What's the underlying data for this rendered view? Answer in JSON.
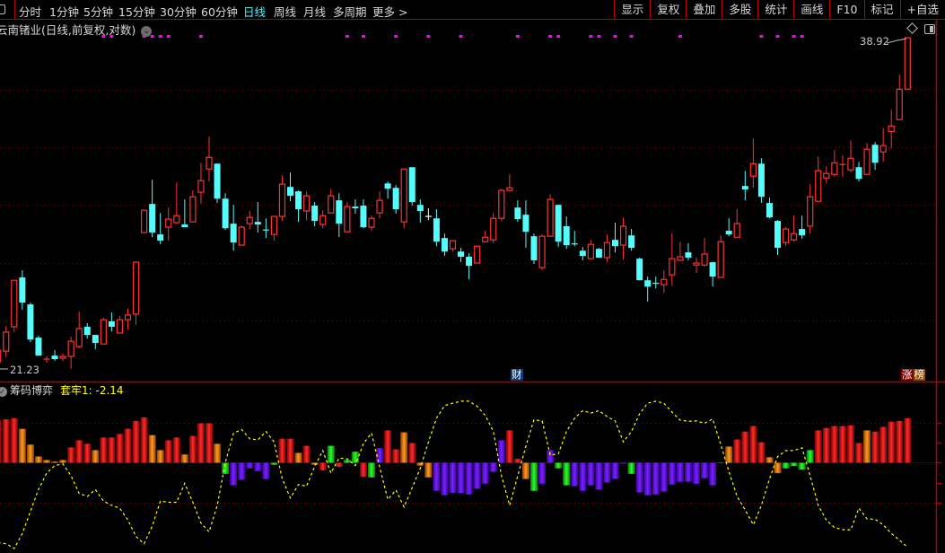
{
  "toolbar": {
    "periods": [
      "分时",
      "1分钟",
      "5分钟",
      "15分钟",
      "30分钟",
      "60分钟",
      "日线",
      "周线",
      "月线",
      "多周期",
      "更多 >"
    ],
    "active_period": "日线",
    "buttons": [
      "显示",
      "复权",
      "叠加",
      "多股",
      "统计",
      "画线",
      "F10",
      "标记",
      "+自选"
    ]
  },
  "title": "云南锗业(日线,前复权,对数)",
  "price_labels": {
    "high": "38.92",
    "low": "21.23"
  },
  "tags": {
    "finance": "财",
    "rank_a": "涨",
    "rank_b": "榜"
  },
  "indicator": {
    "name": "筹码博弈",
    "value_label": "套牢1: -2.14"
  },
  "colors": {
    "up": "#ff3232",
    "down": "#54fcfc",
    "doji": "#ffffff",
    "grid": "#8a0000",
    "frame": "#b00000",
    "signal": "#ff00ff",
    "line": "#ffff00",
    "R": "#ff2020",
    "O": "#ff8a1c",
    "G": "#1ee81e",
    "P": "#6a12ff"
  },
  "chart_data": [
    {
      "type": "candlestick",
      "scale": "log",
      "price_range": [
        21.23,
        38.92
      ],
      "fields": [
        "open",
        "close",
        "high",
        "low"
      ],
      "candles": [
        [
          21.48,
          21.94,
          22.01,
          21.23
        ],
        [
          21.9,
          22.68,
          22.94,
          21.65
        ],
        [
          22.9,
          24.94,
          24.94,
          22.68
        ],
        [
          25.07,
          23.94,
          25.4,
          23.63
        ],
        [
          23.86,
          22.37,
          23.94,
          22.26
        ],
        [
          22.45,
          21.72,
          22.53,
          21.72
        ],
        [
          21.56,
          21.58,
          21.69,
          21.44
        ],
        [
          21.72,
          21.58,
          21.94,
          21.51
        ],
        [
          21.62,
          21.69,
          21.8,
          21.51
        ],
        [
          21.69,
          22.3,
          22.49,
          21.2
        ],
        [
          22.08,
          22.83,
          23.55,
          22.01
        ],
        [
          22.9,
          22.56,
          23.05,
          22.41
        ],
        [
          22.56,
          22.23,
          22.56,
          21.98
        ],
        [
          22.19,
          23.2,
          23.28,
          22.19
        ],
        [
          23.13,
          22.9,
          23.51,
          22.71
        ],
        [
          22.64,
          23.2,
          23.36,
          22.64
        ],
        [
          23.2,
          23.4,
          23.67,
          22.79
        ],
        [
          23.44,
          25.78,
          25.78,
          22.98
        ],
        [
          27.22,
          28.36,
          28.36,
          27.22
        ],
        [
          28.69,
          27.22,
          29.99,
          26.99
        ],
        [
          27.13,
          26.82,
          28.22,
          26.64
        ],
        [
          27.49,
          27.9,
          28.5,
          26.82
        ],
        [
          27.72,
          28.08,
          29.84,
          27.67
        ],
        [
          27.63,
          27.49,
          28.93,
          27.49
        ],
        [
          27.76,
          29.07,
          29.41,
          27.76
        ],
        [
          29.31,
          29.94,
          30.94,
          28.69
        ],
        [
          30.59,
          31.25,
          32.46,
          29.89
        ],
        [
          30.89,
          28.97,
          30.89,
          28.74
        ],
        [
          28.97,
          27.44,
          29.26,
          27.35
        ],
        [
          27.67,
          26.73,
          28.64,
          26.33
        ],
        [
          26.6,
          27.49,
          27.58,
          26.6
        ],
        [
          27.67,
          27.99,
          28.32,
          27.4
        ],
        [
          27.76,
          27.63,
          28.79,
          27.22
        ],
        [
          27.35,
          27.33,
          27.94,
          26.95
        ],
        [
          27.13,
          28.04,
          28.04,
          26.82
        ],
        [
          28.04,
          29.75,
          30.24,
          27.81
        ],
        [
          29.6,
          29.12,
          30.39,
          28.83
        ],
        [
          29.36,
          28.41,
          29.41,
          27.76
        ],
        [
          28.32,
          29.12,
          29.36,
          27.85
        ],
        [
          28.6,
          27.81,
          28.79,
          27.54
        ],
        [
          27.63,
          28.08,
          28.36,
          27.44
        ],
        [
          28.22,
          29.12,
          29.5,
          28.22
        ],
        [
          28.88,
          27.67,
          29.26,
          26.99
        ],
        [
          27.26,
          28.55,
          28.79,
          27.26
        ],
        [
          28.55,
          28.46,
          28.93,
          28.18
        ],
        [
          28.6,
          27.49,
          28.93,
          27.44
        ],
        [
          27.49,
          27.94,
          28.08,
          27.31
        ],
        [
          28.22,
          28.88,
          29.36,
          27.94
        ],
        [
          29.79,
          29.5,
          29.89,
          28.97
        ],
        [
          29.55,
          28.41,
          29.7,
          28.18
        ],
        [
          27.76,
          30.59,
          30.59,
          27.44
        ],
        [
          30.69,
          28.79,
          30.69,
          28.6
        ],
        [
          28.64,
          28.32,
          28.93,
          27.72
        ],
        [
          28.04,
          28.04,
          28.46,
          27.85
        ],
        [
          27.94,
          26.77,
          28.41,
          26.55
        ],
        [
          26.95,
          26.29,
          27.17,
          26.08
        ],
        [
          26.42,
          26.82,
          26.82,
          26.29
        ],
        [
          26.29,
          26.04,
          26.47,
          25.78
        ],
        [
          26.04,
          25.61,
          26.21,
          24.98
        ],
        [
          25.74,
          26.55,
          26.55,
          25.74
        ],
        [
          26.77,
          26.99,
          27.31,
          26.77
        ],
        [
          26.86,
          27.94,
          28.22,
          26.69
        ],
        [
          27.94,
          29.41,
          29.5,
          27.81
        ],
        [
          29.41,
          29.55,
          30.29,
          29.36
        ],
        [
          28.5,
          27.9,
          28.88,
          27.76
        ],
        [
          28.13,
          27.26,
          28.88,
          26.47
        ],
        [
          27.04,
          25.87,
          27.17,
          25.7
        ],
        [
          25.53,
          27.04,
          27.13,
          25.4
        ],
        [
          27.04,
          28.93,
          29.21,
          27.04
        ],
        [
          28.64,
          26.77,
          28.64,
          26.51
        ],
        [
          27.54,
          26.6,
          28.04,
          26.42
        ],
        [
          26.66,
          26.64,
          27.31,
          26.55
        ],
        [
          26.33,
          26.08,
          26.51,
          25.87
        ],
        [
          25.95,
          26.64,
          26.86,
          25.91
        ],
        [
          26.42,
          26.0,
          26.47,
          26.0
        ],
        [
          26.0,
          26.73,
          27.13,
          25.78
        ],
        [
          26.86,
          26.55,
          27.72,
          26.25
        ],
        [
          26.6,
          27.54,
          27.99,
          25.91
        ],
        [
          27.08,
          26.47,
          27.4,
          26.33
        ],
        [
          25.95,
          24.94,
          26.0,
          24.94
        ],
        [
          24.94,
          24.65,
          25.11,
          23.98
        ],
        [
          24.8,
          24.78,
          25.11,
          24.57
        ],
        [
          24.74,
          24.98,
          25.4,
          24.37
        ],
        [
          25.19,
          25.95,
          27.17,
          24.69
        ],
        [
          25.87,
          26.04,
          26.77,
          25.87
        ],
        [
          26.25,
          26.0,
          26.69,
          25.87
        ],
        [
          25.65,
          25.74,
          26.0,
          25.28
        ],
        [
          25.65,
          26.17,
          26.95,
          25.57
        ],
        [
          25.78,
          25.11,
          25.78,
          24.65
        ],
        [
          25.07,
          26.77,
          27.08,
          25.07
        ],
        [
          27.31,
          27.13,
          27.94,
          27.04
        ],
        [
          26.99,
          27.67,
          28.41,
          26.99
        ],
        [
          29.65,
          29.46,
          30.49,
          28.88
        ],
        [
          30.19,
          30.89,
          32.35,
          29.55
        ],
        [
          30.89,
          29.07,
          31.2,
          28.74
        ],
        [
          28.74,
          27.99,
          29.02,
          27.94
        ],
        [
          27.81,
          26.47,
          27.85,
          26.12
        ],
        [
          26.73,
          27.4,
          27.49,
          26.55
        ],
        [
          26.86,
          27.17,
          28.08,
          26.77
        ],
        [
          27.4,
          27.08,
          28.08,
          26.91
        ],
        [
          27.54,
          29.07,
          29.75,
          27.17
        ],
        [
          28.83,
          30.49,
          31.3,
          28.83
        ],
        [
          30.09,
          30.34,
          30.74,
          29.79
        ],
        [
          30.29,
          30.94,
          31.67,
          30.14
        ],
        [
          30.81,
          30.84,
          31.35,
          30.14
        ],
        [
          30.54,
          31.2,
          32.24,
          30.39
        ],
        [
          30.69,
          30.04,
          30.99,
          29.89
        ],
        [
          30.29,
          31.72,
          32.08,
          30.29
        ],
        [
          31.98,
          30.94,
          32.14,
          30.54
        ],
        [
          31.56,
          31.93,
          32.99,
          30.99
        ],
        [
          32.77,
          33.1,
          34.1,
          31.77
        ],
        [
          33.49,
          35.41,
          36.36,
          33.49
        ],
        [
          35.41,
          38.92,
          38.92,
          35.41
        ]
      ],
      "signal_marks": [
        13,
        14,
        18,
        19,
        20,
        21,
        25,
        43,
        45,
        49,
        53,
        57,
        64,
        68,
        69,
        73,
        74,
        76,
        78,
        84,
        94,
        96,
        98,
        99
      ],
      "high_label_index": 112,
      "low_label_index": 9
    },
    {
      "type": "bar+line",
      "title": "筹码博弈",
      "y_grid": [
        -1,
        0,
        1
      ],
      "bars": [
        1.07,
        1.1,
        1.13,
        0.86,
        0.46,
        0.16,
        0.07,
        0.03,
        0.07,
        0.39,
        0.57,
        0.48,
        0.32,
        0.64,
        0.64,
        0.73,
        0.86,
        1.06,
        1.15,
        0.7,
        0.32,
        0.57,
        0.64,
        0.21,
        0.68,
        1.0,
        1.0,
        0.48,
        -0.28,
        -0.57,
        -0.43,
        -0.14,
        -0.21,
        -0.41,
        -0.05,
        0.61,
        0.61,
        0.25,
        0.43,
        -0.05,
        -0.19,
        0.43,
        -0.1,
        0.07,
        0.28,
        -0.35,
        -0.37,
        0.37,
        0.82,
        0.34,
        0.77,
        0.5,
        -0.07,
        -0.37,
        -0.71,
        -0.82,
        -0.76,
        -0.77,
        -0.8,
        -0.66,
        -0.53,
        -0.23,
        0.57,
        0.82,
        0.1,
        -0.41,
        -0.71,
        -0.53,
        0.32,
        -0.14,
        -0.57,
        -0.59,
        -0.71,
        -0.57,
        -0.68,
        -0.5,
        -0.41,
        -0.02,
        -0.28,
        -0.75,
        -0.82,
        -0.8,
        -0.73,
        -0.55,
        -0.48,
        -0.48,
        -0.53,
        -0.39,
        -0.57,
        0.01,
        0.41,
        0.59,
        0.79,
        0.93,
        0.52,
        0.14,
        -0.26,
        -0.14,
        -0.08,
        -0.17,
        0.32,
        0.82,
        0.88,
        0.93,
        0.93,
        0.95,
        0.5,
        0.82,
        0.79,
        0.91,
        1.04,
        1.06,
        1.13
      ],
      "bar_colors": "RRROOOOOORRRORRRRRROORRORRROGPPPPPGRRORORGRGGRGPRROROOPPPPPPPPPRROGPPGGPPPPPPPGPPPPPPPPPPPORRRROOGGGGRRRRRRORRRRRR",
      "line_name": "套牢1",
      "line": [
        -2.02,
        -2.05,
        -2.17,
        -1.79,
        -1.23,
        -0.67,
        -0.26,
        -0.07,
        -0.03,
        -0.33,
        -0.78,
        -0.85,
        -0.68,
        -0.97,
        -1.08,
        -1.15,
        -1.45,
        -1.87,
        -2.05,
        -1.6,
        -0.97,
        -1.0,
        -1.0,
        -0.52,
        -1.0,
        -1.53,
        -1.75,
        -1.08,
        0.01,
        0.75,
        0.84,
        0.61,
        0.58,
        0.79,
        0.53,
        -0.4,
        -0.89,
        -0.55,
        -0.59,
        -0.09,
        0.31,
        -0.26,
        0.12,
        0.1,
        -0.07,
        0.49,
        0.75,
        -0.11,
        -0.93,
        -0.69,
        -1.12,
        -0.63,
        -0.14,
        0.53,
        1.13,
        1.45,
        1.51,
        1.56,
        1.56,
        1.43,
        1.2,
        0.79,
        -0.33,
        -1.08,
        -0.33,
        0.42,
        1.09,
        1.06,
        0.19,
        0.23,
        0.79,
        1.13,
        1.32,
        1.26,
        1.32,
        1.17,
        1.06,
        0.53,
        0.79,
        1.24,
        1.51,
        1.56,
        1.51,
        1.28,
        1.08,
        1.05,
        1.06,
        1.0,
        1.11,
        0.46,
        -0.22,
        -0.85,
        -1.19,
        -1.57,
        -1.08,
        -0.4,
        0.16,
        0.31,
        0.31,
        0.38,
        -0.33,
        -1.08,
        -1.45,
        -1.64,
        -1.69,
        -1.7,
        -1.15,
        -1.42,
        -1.43,
        -1.57,
        -1.79,
        -1.96,
        -2.14
      ]
    }
  ]
}
